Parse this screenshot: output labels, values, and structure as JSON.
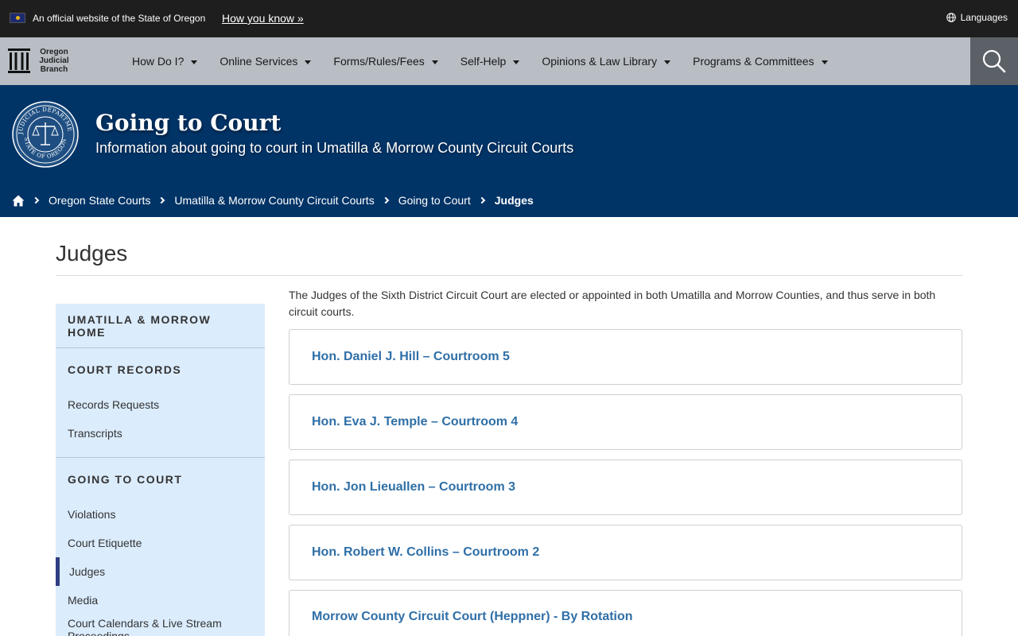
{
  "gov_banner": {
    "official_text": "An official website of the State of Oregon",
    "how_link": "How you know »",
    "languages": "Languages"
  },
  "logo": {
    "line1": "Oregon",
    "line2": "Judicial",
    "line3": "Branch"
  },
  "nav": {
    "items": [
      {
        "label": "How Do I?"
      },
      {
        "label": "Online Services"
      },
      {
        "label": "Forms/Rules/Fees"
      },
      {
        "label": "Self-Help"
      },
      {
        "label": "Opinions & Law Library"
      },
      {
        "label": "Programs & Committees"
      }
    ]
  },
  "hero": {
    "title": "Going to Court",
    "subtitle": "Information about going to court in Umatilla & Morrow County Circuit Courts",
    "seal_text": [
      "JUDICIAL DEPARTMENT",
      "STATE OF OREGON"
    ]
  },
  "breadcrumb": {
    "items": [
      {
        "label": "Oregon State Courts"
      },
      {
        "label": "Umatilla & Morrow County Circuit Courts"
      },
      {
        "label": "Going to Court"
      }
    ],
    "current": "Judges"
  },
  "page": {
    "title": "Judges",
    "intro": "The Judges of the Sixth District Circuit Court are elected or appointed in both Umatilla and Morrow Counties, and thus serve in both circuit courts."
  },
  "sidebar": {
    "home": "UMATILLA & MORROW HOME",
    "sections": [
      {
        "heading": "COURT RECORDS",
        "links": [
          "Records Requests",
          "Transcripts"
        ]
      },
      {
        "heading": "GOING TO COURT",
        "links": [
          "Violations",
          "Court Etiquette",
          "Judges",
          "Media",
          "Court Calendars & Live Stream Proceedings"
        ]
      }
    ]
  },
  "judges": [
    {
      "label": "Hon. Daniel J. Hill – Courtroom 5"
    },
    {
      "label": "Hon. Eva J. Temple – Courtroom 4"
    },
    {
      "label": "Hon. Jon Lieuallen – Courtroom 3"
    },
    {
      "label": "Hon. Robert W. Collins – Courtroom 2"
    },
    {
      "label": "Morrow County Circuit Court (Heppner) - By Rotation"
    }
  ],
  "colors": {
    "banner": "#1e1e1e",
    "nav": "#b8bec4",
    "hero": "#003366",
    "sidebar": "#dbecfd",
    "link": "#2f6fa7",
    "active_marker": "#2e3d82"
  },
  "icons": [
    "flag-icon",
    "globe-icon",
    "logo-icon",
    "caret-down-icon",
    "search-icon",
    "seal-icon",
    "home-icon",
    "chevron-right-icon"
  ]
}
